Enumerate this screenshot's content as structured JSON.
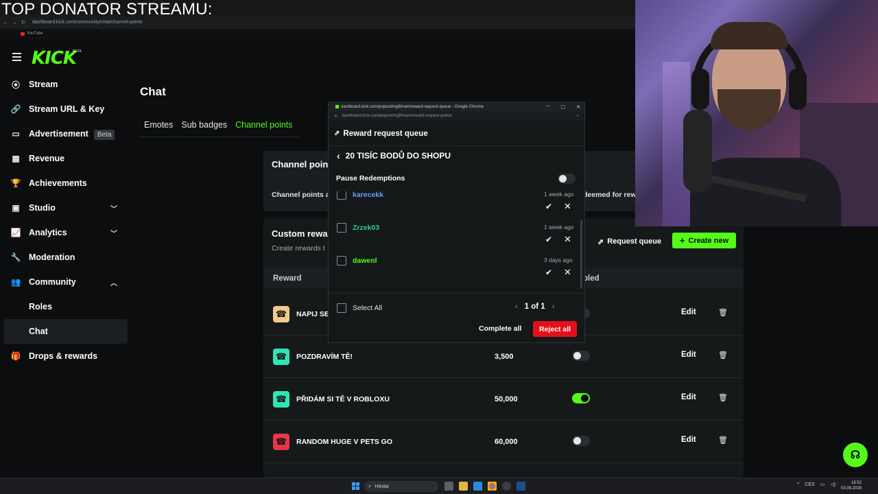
{
  "overlay": {
    "title": "TOP DONATOR STREAMU:"
  },
  "browser": {
    "url": "dashboard.kick.com/community/chat/channel-points",
    "bookmark": "YouTube"
  },
  "logo": {
    "text": "KICK",
    "beta": "BETA"
  },
  "sidebar": {
    "items": [
      {
        "label": "Stream",
        "icon": "stream-icon",
        "glyph": "⦿"
      },
      {
        "label": "Stream URL & Key",
        "icon": "link-icon",
        "glyph": "🔗"
      },
      {
        "label": "Advertisement",
        "icon": "advertisement-icon",
        "glyph": "▭",
        "badge": "Beta"
      },
      {
        "label": "Revenue",
        "icon": "revenue-icon",
        "glyph": "▦"
      },
      {
        "label": "Achievements",
        "icon": "trophy-icon",
        "glyph": "🏆"
      },
      {
        "label": "Studio",
        "icon": "studio-icon",
        "glyph": "▣",
        "chevron": "down"
      },
      {
        "label": "Analytics",
        "icon": "analytics-icon",
        "glyph": "📈",
        "chevron": "down"
      },
      {
        "label": "Moderation",
        "icon": "moderation-icon",
        "glyph": "🔧"
      },
      {
        "label": "Community",
        "icon": "community-icon",
        "glyph": "👥",
        "chevron": "up"
      },
      {
        "label": "Roles"
      },
      {
        "label": "Chat",
        "active": true
      },
      {
        "label": "Drops & rewards",
        "icon": "gift-icon",
        "glyph": "🎁"
      }
    ]
  },
  "main": {
    "title": "Chat",
    "tabs": [
      {
        "label": "Emotes"
      },
      {
        "label": "Sub badges"
      },
      {
        "label": "Channel points",
        "active": true
      }
    ],
    "channel_points_card": {
      "title": "Channel poin",
      "desc": "Channel points a",
      "desc_right": "deemed for rew"
    },
    "custom_rewards": {
      "title": "Custom rewa",
      "subtitle": "Create rewards t",
      "request_queue": "Request queue",
      "create_new": "Create new",
      "col_reward": "Reward",
      "col_enabled": "bled",
      "rows": [
        {
          "name": "NAPIJ SE",
          "cost": "",
          "enabled": false,
          "color": "#f2c98a",
          "edit": "Edit"
        },
        {
          "name": "POZDRAVÍM TĚ!",
          "cost": "3,500",
          "enabled": false,
          "color": "#2ee6b4",
          "edit": "Edit"
        },
        {
          "name": "PŘIDÁM SI TĚ V ROBLOXU",
          "cost": "50,000",
          "enabled": true,
          "color": "#2ee6b4",
          "edit": "Edit"
        },
        {
          "name": "RANDOM HUGE V PETS GO",
          "cost": "60,000",
          "enabled": false,
          "color": "#e8354a",
          "edit": "Edit"
        }
      ]
    }
  },
  "popup": {
    "window_title": "dashboard.kick.com/popout/mgfitman/reward-request-queue - Google Chrome",
    "url": "dashboard.kick.com/popout/mgfitman/reward-request-queue",
    "header": "Reward request queue",
    "reward_title": "20 TISÍC BODŮ DO SHOPU",
    "pause_label": "Pause Redemptions",
    "queue": [
      {
        "user": "karecekk",
        "time": "1 week ago",
        "color": "#6b9bff"
      },
      {
        "user": "Zrzek03",
        "time": "1 week ago",
        "color": "#2ecf8a"
      },
      {
        "user": "dawenl",
        "time": "3 days ago",
        "color": "#53fc18"
      }
    ],
    "select_all": "Select All",
    "pager": "1 of 1",
    "complete_all": "Complete all",
    "reject_all": "Reject all"
  },
  "taskbar": {
    "search": "Hledat",
    "lang": "CES",
    "time": "18:52",
    "date": "03.08.2026"
  },
  "colors": {
    "accent": "#53fc18",
    "danger": "#e3101b",
    "bg": "#0b0d0e"
  }
}
